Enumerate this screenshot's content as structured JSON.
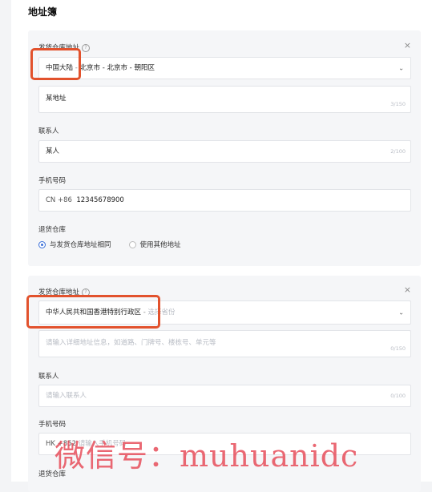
{
  "page": {
    "title": "地址簿"
  },
  "card1": {
    "warehouse_label": "发货仓库地址",
    "help_glyph": "?",
    "close_glyph": "×",
    "region": {
      "country": "中国大陆",
      "sep": "-",
      "rest": "北京市 - 北京市 - 朝阳区"
    },
    "address": {
      "value": "某地址",
      "count": "3/150"
    },
    "contact_label": "联系人",
    "contact": {
      "value": "某人",
      "count": "2/100"
    },
    "phone_label": "手机号码",
    "phone": {
      "code": "CN +86",
      "number": "12345678900"
    },
    "return_label": "退货仓库",
    "return_options": [
      {
        "label": "与发货仓库地址相同",
        "selected": true
      },
      {
        "label": "使用其他地址",
        "selected": false
      }
    ]
  },
  "card2": {
    "warehouse_label": "发货仓库地址",
    "help_glyph": "?",
    "close_glyph": "×",
    "region": {
      "country": "中华人民共和国香港特别行政区",
      "sep": "-",
      "placeholder": "选择省份"
    },
    "address": {
      "placeholder": "请输入详细地址信息，如道路、门牌号、楼栋号、单元等",
      "count": "0/150"
    },
    "contact_label": "联系人",
    "contact": {
      "placeholder": "请输入联系人",
      "count": "0/100"
    },
    "phone_label": "手机号码",
    "phone": {
      "code": "HK +852",
      "placeholder": "请输入手机号码"
    },
    "return_label": "退货仓库"
  },
  "icons": {
    "chevron": "⌄"
  },
  "colors": {
    "accent": "#3a6fd8",
    "highlight": "#e2522d",
    "watermark": "#e64e5a"
  },
  "watermark": {
    "text": "微信号：muhuanidc"
  }
}
